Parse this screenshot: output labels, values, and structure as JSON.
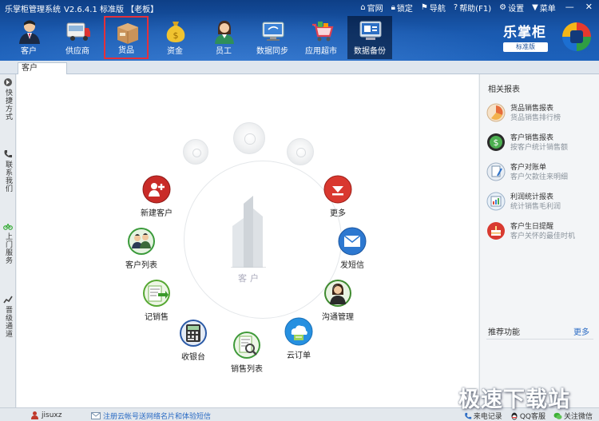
{
  "app": {
    "title": "乐掌柜管理系统",
    "version": "V2.6.4.1 标准版 【老板】"
  },
  "top_menu": [
    {
      "label": "官网",
      "icon": "home-icon"
    },
    {
      "label": "锁定",
      "icon": "lock-icon"
    },
    {
      "label": "导航",
      "icon": "flag-icon"
    },
    {
      "label": "帮助(F1)",
      "icon": "help-icon"
    },
    {
      "label": "设置",
      "icon": "gear-icon"
    },
    {
      "label": "菜单",
      "icon": "shirt-icon"
    }
  ],
  "window_controls": {
    "minimize": "—",
    "close": "✕"
  },
  "nav": [
    {
      "label": "客户",
      "icon": "customer-icon"
    },
    {
      "label": "供应商",
      "icon": "truck-icon"
    },
    {
      "label": "货品",
      "icon": "box-icon",
      "selected": true
    },
    {
      "label": "资金",
      "icon": "money-bag-icon"
    },
    {
      "label": "员工",
      "icon": "employee-icon"
    },
    {
      "label": "数据同步",
      "icon": "sync-icon"
    },
    {
      "label": "应用超市",
      "icon": "cart-icon"
    },
    {
      "label": "数据备份",
      "icon": "backup-icon",
      "dark": true
    }
  ],
  "brand": {
    "name": "乐掌柜",
    "edition": "标准版"
  },
  "tabs": [
    {
      "label": "客户",
      "active": true
    }
  ],
  "sidebar": [
    {
      "label": "快捷方式",
      "icon": "shortcut-icon"
    },
    {
      "label": "联系我们",
      "icon": "phone-icon"
    },
    {
      "label": "上门服务",
      "icon": "bicycle-icon"
    },
    {
      "label": "晋级通道",
      "icon": "trend-icon"
    }
  ],
  "main": {
    "center_label": "客户",
    "features": [
      {
        "label": "新建客户",
        "icon": "add-customer-icon"
      },
      {
        "label": "更多",
        "icon": "more-icon"
      },
      {
        "label": "客户列表",
        "icon": "customer-list-icon"
      },
      {
        "label": "发短信",
        "icon": "sms-icon"
      },
      {
        "label": "记销售",
        "icon": "record-sale-icon"
      },
      {
        "label": "沟通管理",
        "icon": "communication-icon"
      },
      {
        "label": "收银台",
        "icon": "cashier-icon"
      },
      {
        "label": "云订单",
        "icon": "cloud-order-icon"
      },
      {
        "label": "销售列表",
        "icon": "sales-list-icon"
      }
    ]
  },
  "right": {
    "title": "相关报表",
    "reports": [
      {
        "title": "货品销售报表",
        "sub": "货品销售排行榜",
        "icon": "pie-chart-icon"
      },
      {
        "title": "客户销售报表",
        "sub": "按客户统计销售额",
        "icon": "dollar-icon"
      },
      {
        "title": "客户对账单",
        "sub": "客户欠款往来明细",
        "icon": "statement-icon"
      },
      {
        "title": "利润统计报表",
        "sub": "统计销售毛利润",
        "icon": "profit-icon"
      },
      {
        "title": "客户生日提醒",
        "sub": "客户关怀的最佳时机",
        "icon": "birthday-icon"
      }
    ],
    "recommend_title": "推荐功能",
    "recommend_more": "更多"
  },
  "status": {
    "user": "jisuxz",
    "register_link": "注册云帐号送网络名片和体验短信",
    "right_items": [
      {
        "label": "来电记录",
        "icon": "call-log-icon"
      },
      {
        "label": "QQ客服",
        "icon": "qq-icon"
      },
      {
        "label": "关注微信",
        "icon": "wechat-icon"
      }
    ]
  },
  "watermark": "极速下载站"
}
